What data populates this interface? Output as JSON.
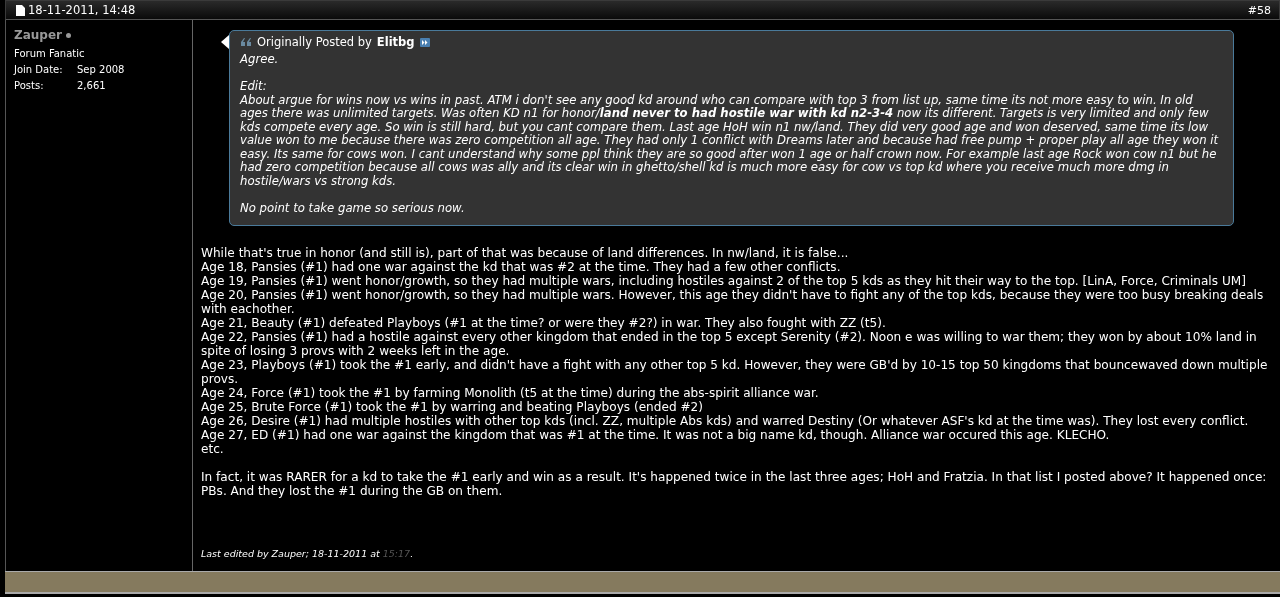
{
  "post_header": {
    "date": "18-11-2011, 14:48",
    "post_number": "#58"
  },
  "user": {
    "name": "Zauper",
    "title": "Forum Fanatic",
    "details": [
      {
        "label": "Join Date:",
        "value": "Sep 2008"
      },
      {
        "label": "Posts:",
        "value": "2,661"
      }
    ]
  },
  "quote": {
    "prefix": "Originally Posted by",
    "author": "Elitbg",
    "paragraphs": [
      [
        "Agree."
      ],
      [
        "Edit:",
        "About argue for wins now vs wins in past. ATM i don't see any good kd around who can compare with top 3 from list up, same time its not more easy to win. In old ages there was unlimited targets. Was often KD n1 for honor/**land never to had hostile war with kd n2-3-4** now its different. Targets is very limited and only few kds compete every age. So win is still hard, but you cant compare them. Last age HoH win n1 nw/land. They did very good age and won deserved, same time its low value won to me because there was zero competition all age. They had only 1 conflict with Dreams later and because had free pump + proper play all age they won it easy. Its same for cows won. I cant understand why some ppl think they are so good after won 1 age or half crown now. For example last age Rock won cow n1 but he had zero competition because all cows was ally and its clear win in ghetto/shell kd is much more easy for cow vs top kd where you receive much more dmg in hostile/wars vs strong kds."
      ],
      [
        "No point to take game so serious now."
      ]
    ]
  },
  "body": [
    [
      "While that's true in honor (and still is), part of that was because of land differences. In nw/land, it is false...",
      "Age 18, Pansies (#1) had one war against the kd that was #2 at the time. They had a few other conflicts.",
      "Age 19, Pansies (#1) went honor/growth, so they had multiple wars, including hostiles against 2 of the top 5 kds as they hit their way to the top. [LinA, Force, Criminals UM]",
      "Age 20, Pansies (#1) went honor/growth, so they had multiple wars. However, this age they didn't have to fight any of the top kds, because they were too busy breaking deals with eachother.",
      "Age 21, Beauty (#1) defeated Playboys (#1 at the time? or were they #2?) in war. They also fought with ZZ (t5).",
      "Age 22, Pansies (#1) had a hostile against every other kingdom that ended in the top 5 except Serenity (#2). Noon e was willing to war them; they won by about 10% land in spite of losing 3 provs with 2 weeks left in the age.",
      "Age 23, Playboys (#1) took the #1 early, and didn't have a fight with any other top 5 kd. However, they were GB'd by 10-15 top 50 kingdoms that bouncewaved down multiple provs.",
      "Age 24, Force (#1) took the #1 by farming Monolith (t5 at the time) during the abs-spirit alliance war.",
      "Age 25, Brute Force (#1) took the #1 by warring and beating Playboys (ended #2)",
      "Age 26, Desire (#1) had multiple hostiles with other top kds (incl. ZZ, multiple Abs kds) and warred Destiny (Or whatever ASF's kd at the time was). They lost every conflict.",
      "Age 27, ED (#1) had one war against the kingdom that was #1 at the time. It was not a big name kd, though. Alliance war occured this age. KLECHO.",
      "etc."
    ],
    [
      "In fact, it was RARER for a kd to take the #1 early and win as a result. It's happened twice in the last three ages; HoH and Fratzia. In that list I posted above? It happened once: PBs. And they lost the #1 during the GB on them."
    ]
  ],
  "edit_note": {
    "text": "Last edited by Zauper; 18-11-2011 at",
    "time": "15:17",
    "end": "."
  }
}
